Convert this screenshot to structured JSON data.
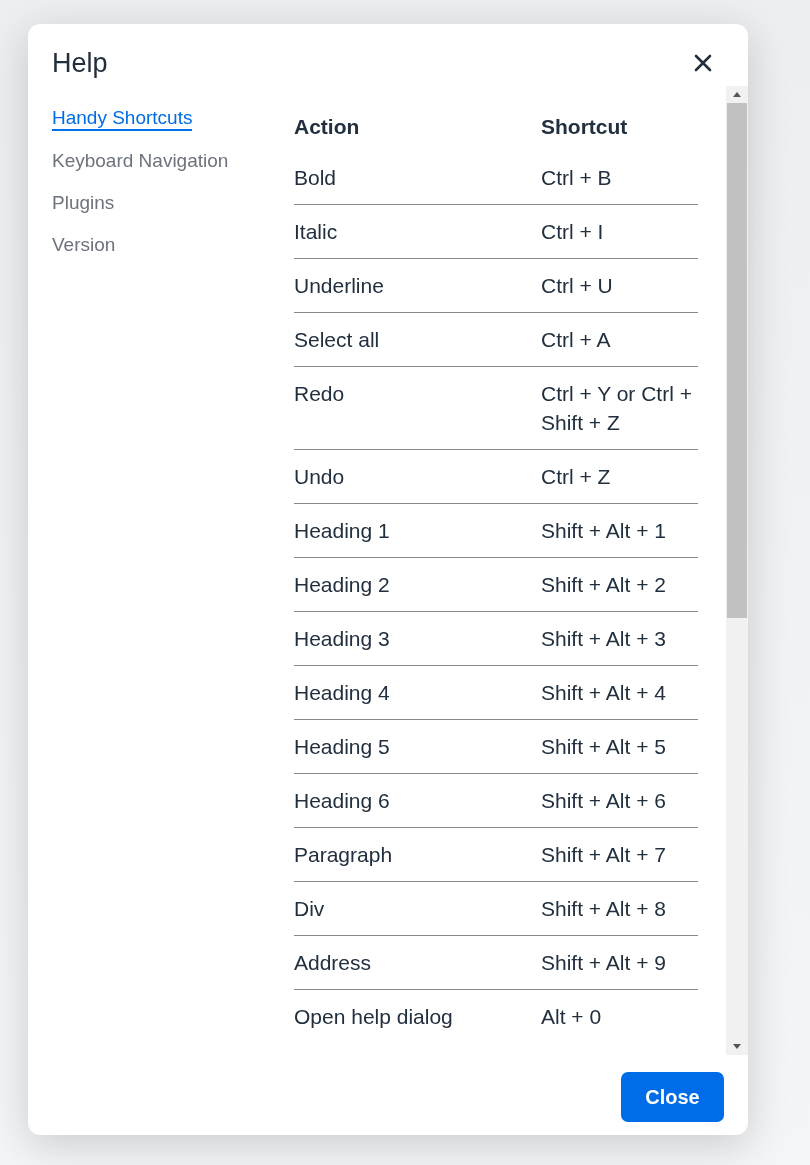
{
  "dialog": {
    "title": "Help",
    "nav": [
      {
        "label": "Handy Shortcuts",
        "selected": true
      },
      {
        "label": "Keyboard Navigation",
        "selected": false
      },
      {
        "label": "Plugins",
        "selected": false
      },
      {
        "label": "Version",
        "selected": false
      }
    ],
    "table": {
      "columns": [
        "Action",
        "Shortcut"
      ],
      "rows": [
        [
          "Bold",
          "Ctrl + B"
        ],
        [
          "Italic",
          "Ctrl + I"
        ],
        [
          "Underline",
          "Ctrl + U"
        ],
        [
          "Select all",
          "Ctrl + A"
        ],
        [
          "Redo",
          "Ctrl + Y or Ctrl + Shift + Z"
        ],
        [
          "Undo",
          "Ctrl + Z"
        ],
        [
          "Heading 1",
          "Shift + Alt + 1"
        ],
        [
          "Heading 2",
          "Shift + Alt + 2"
        ],
        [
          "Heading 3",
          "Shift + Alt + 3"
        ],
        [
          "Heading 4",
          "Shift + Alt + 4"
        ],
        [
          "Heading 5",
          "Shift + Alt + 5"
        ],
        [
          "Heading 6",
          "Shift + Alt + 6"
        ],
        [
          "Paragraph",
          "Shift + Alt + 7"
        ],
        [
          "Div",
          "Shift + Alt + 8"
        ],
        [
          "Address",
          "Shift + Alt + 9"
        ],
        [
          "Open help dialog",
          "Alt + 0"
        ]
      ]
    },
    "close_button": "Close"
  }
}
